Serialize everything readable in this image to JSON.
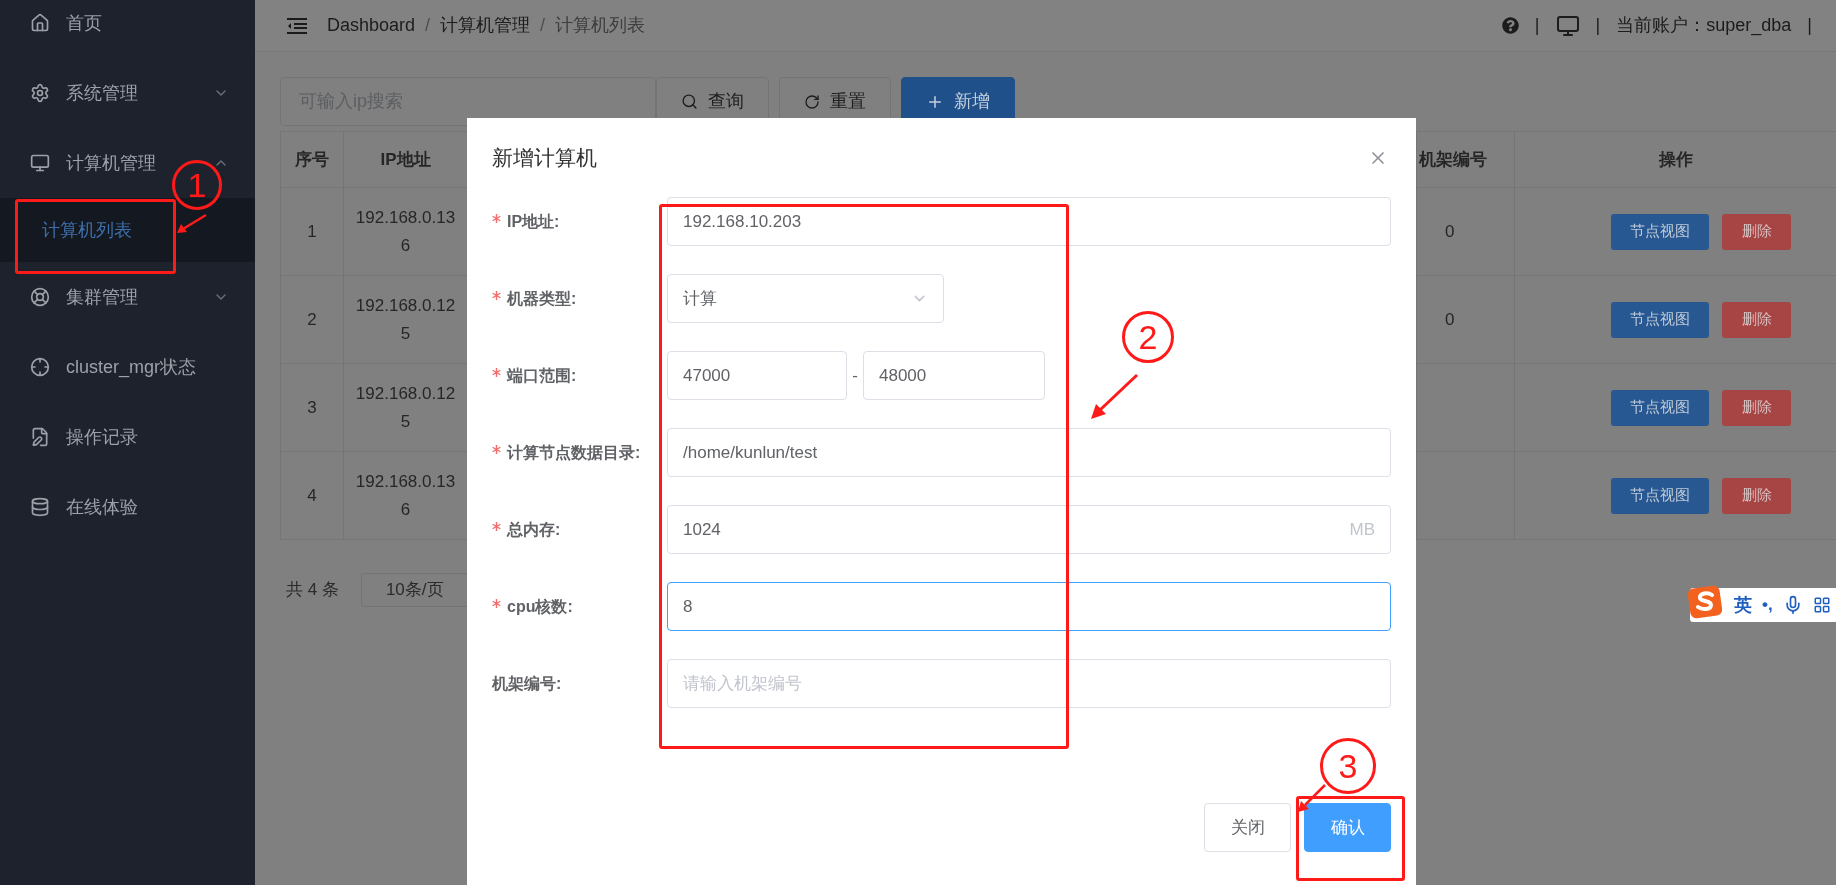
{
  "sidebar": {
    "items": [
      {
        "label": "首页",
        "kind": "link"
      },
      {
        "label": "系统管理",
        "kind": "submenu",
        "expanded": false
      },
      {
        "label": "计算机管理",
        "kind": "submenu",
        "expanded": true,
        "children": [
          {
            "label": "计算机列表",
            "selected": true
          }
        ]
      },
      {
        "label": "集群管理",
        "kind": "submenu",
        "expanded": false
      },
      {
        "label": "cluster_mgr状态",
        "kind": "link"
      },
      {
        "label": "操作记录",
        "kind": "link"
      },
      {
        "label": "在线体验",
        "kind": "link"
      }
    ]
  },
  "header": {
    "breadcrumb": [
      "Dashboard",
      "计算机管理",
      "计算机列表"
    ],
    "breadcrumb_separators": [
      "/",
      "/"
    ],
    "account": "当前账户：super_dba",
    "separators": [
      "|",
      "|",
      "|"
    ]
  },
  "toolbar": {
    "search": {
      "placeholder": "可输入ip搜索"
    },
    "buttons": [
      {
        "label": "查询",
        "kind": "search"
      },
      {
        "label": "重置",
        "kind": "reset"
      },
      {
        "label": "新增",
        "kind": "primary"
      }
    ]
  },
  "table": {
    "columns": [
      "序号",
      "IP地址",
      "机架编号",
      "操作"
    ],
    "rows": [
      {
        "index": "1",
        "ip": "192.168.0.136",
        "rack": "0",
        "actions": [
          "节点视图",
          "删除"
        ]
      },
      {
        "index": "2",
        "ip": "192.168.0.125",
        "rack": "0",
        "actions": [
          "节点视图",
          "删除"
        ]
      },
      {
        "index": "3",
        "ip": "192.168.0.125",
        "actions": [
          "节点视图",
          "删除"
        ]
      },
      {
        "index": "4",
        "ip": "192.168.0.136",
        "actions": [
          "节点视图",
          "删除"
        ]
      }
    ]
  },
  "pagination": {
    "total": "共 4 条",
    "page_size": "10条/页"
  },
  "dialog": {
    "title": "新增计算机",
    "fields": [
      {
        "kind": "text",
        "label": "IP地址:",
        "required": true,
        "focused": false,
        "value": "192.168.10.203"
      },
      {
        "kind": "select",
        "label": "机器类型:",
        "required": true,
        "focused": false,
        "value": "计算"
      },
      {
        "kind": "range",
        "label": "端口范围:",
        "required": true,
        "focused": false,
        "from": "47000",
        "separator": "-",
        "to": "48000"
      },
      {
        "kind": "text",
        "label": "计算节点数据目录:",
        "required": true,
        "focused": false,
        "value": "/home/kunlun/test"
      },
      {
        "kind": "text",
        "label": "总内存:",
        "required": true,
        "focused": false,
        "value": "1024",
        "suffix": "MB"
      },
      {
        "kind": "text",
        "label": "cpu核数:",
        "required": true,
        "focused": true,
        "value": "8"
      },
      {
        "kind": "text",
        "label": "机架编号:",
        "required": false,
        "focused": false,
        "placeholder": "请输入机架编号"
      }
    ],
    "buttons": [
      {
        "label": "关闭",
        "kind": "default"
      },
      {
        "label": "确认",
        "kind": "primary"
      }
    ]
  },
  "ime_toolbar": {
    "mode": "英",
    "punctuation": "•,"
  },
  "annotations": [
    {
      "number": "1"
    },
    {
      "number": "2"
    },
    {
      "number": "3"
    }
  ]
}
